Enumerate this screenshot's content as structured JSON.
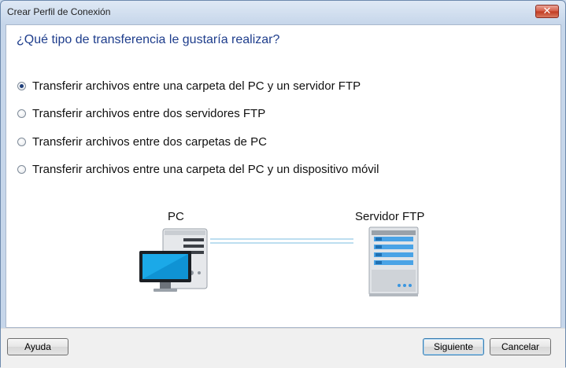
{
  "window": {
    "title": "Crear Perfil de Conexión",
    "close_symbol": "✕"
  },
  "question": "¿Qué tipo de transferencia le gustaría realizar?",
  "options": [
    {
      "label": "Transferir archivos entre una carpeta del PC y un servidor FTP",
      "checked": true
    },
    {
      "label": "Transferir archivos entre dos servidores FTP",
      "checked": false
    },
    {
      "label": "Transferir archivos entre dos carpetas de PC",
      "checked": false
    },
    {
      "label": "Transferir archivos entre una carpeta del PC y un dispositivo móvil",
      "checked": false
    }
  ],
  "diagram": {
    "left_label": "PC",
    "right_label": "Servidor FTP",
    "left_icon": "desktop-pc-icon",
    "right_icon": "ftp-server-icon"
  },
  "buttons": {
    "help": "Ayuda",
    "next": "Siguiente",
    "cancel": "Cancelar"
  },
  "colors": {
    "accent": "#1e3d8c",
    "monitor": "#1ba9e8",
    "server_led": "#4aa3e6"
  }
}
